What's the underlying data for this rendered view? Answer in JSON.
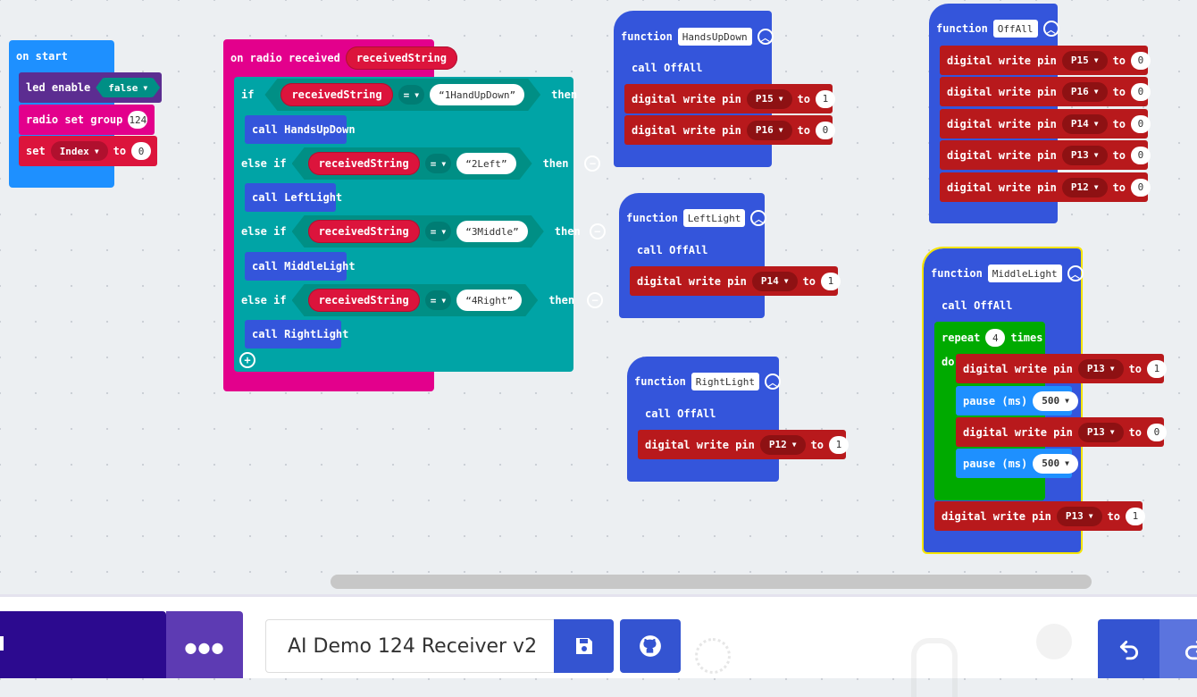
{
  "on_start": {
    "header": "on start",
    "led_enable": {
      "label": "led enable",
      "value": "false"
    },
    "radio_group": {
      "label": "radio set group",
      "value": "124"
    },
    "set_index": {
      "label": "set",
      "var": "Index",
      "to": "to",
      "value": "0"
    }
  },
  "radio": {
    "header": "on radio received",
    "param": "receivedString",
    "if_label": "if",
    "else_if_label": "else if",
    "then_label": "then",
    "op": "=",
    "branches": [
      {
        "var": "receivedString",
        "str": "1HandUpDown",
        "call": "call HandsUpDown"
      },
      {
        "var": "receivedString",
        "str": "2Left",
        "call": "call LeftLight"
      },
      {
        "var": "receivedString",
        "str": "3Middle",
        "call": "call MiddleLight"
      },
      {
        "var": "receivedString",
        "str": "4Right",
        "call": "call RightLight"
      }
    ]
  },
  "functions": {
    "keyword": "function",
    "dwp": "digital write pin",
    "to": "to",
    "call_offall": "call OffAll",
    "handsupdown": {
      "name": "HandsUpDown",
      "rows": [
        {
          "pin": "P15",
          "val": "1"
        },
        {
          "pin": "P16",
          "val": "0"
        }
      ]
    },
    "leftlight": {
      "name": "LeftLight",
      "rows": [
        {
          "pin": "P14",
          "val": "1"
        }
      ]
    },
    "rightlight": {
      "name": "RightLight",
      "rows": [
        {
          "pin": "P12",
          "val": "1"
        }
      ]
    },
    "offall": {
      "name": "OffAll",
      "rows": [
        {
          "pin": "P15",
          "val": "0"
        },
        {
          "pin": "P16",
          "val": "0"
        },
        {
          "pin": "P14",
          "val": "0"
        },
        {
          "pin": "P13",
          "val": "0"
        },
        {
          "pin": "P12",
          "val": "0"
        }
      ]
    },
    "middlelight": {
      "name": "MiddleLight",
      "repeat": "repeat",
      "times_value": "4",
      "times": "times",
      "do": "do",
      "pause_label": "pause (ms)",
      "pause_value": "500",
      "loop_rows": [
        {
          "pin": "P13",
          "val": "1"
        },
        {
          "pin": "P13",
          "val": "0"
        }
      ],
      "after": {
        "pin": "P13",
        "val": "1"
      }
    }
  },
  "bottom": {
    "project_name": "AI Demo 124 Receiver v2",
    "more": "●●●",
    "save_icon": "floppy-disk-icon",
    "github_icon": "github-icon",
    "undo_icon": "undo-icon"
  },
  "colors": {
    "basic": "#1e90ff",
    "radio": "#e3008c",
    "logic": "#00a4a6",
    "functions": "#3455db",
    "pins": "#b8191c",
    "led": "#5c2d91",
    "variables": "#dc143c",
    "loops": "#00aa00"
  }
}
